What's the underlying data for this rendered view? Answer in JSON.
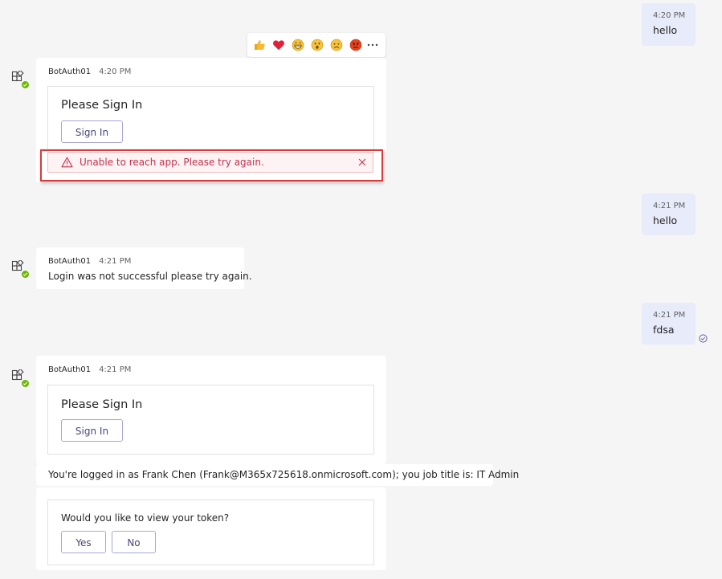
{
  "messages": {
    "m1": {
      "time": "4:20 PM",
      "text": "hello"
    },
    "m2": {
      "sender": "BotAuth01",
      "time": "4:20 PM",
      "card_title": "Please Sign In",
      "sign_in_label": "Sign In",
      "error_text": "Unable to reach app. Please try again."
    },
    "m3": {
      "time": "4:21 PM",
      "text": "hello"
    },
    "m4": {
      "sender": "BotAuth01",
      "time": "4:21 PM",
      "text": "Login was not successful please try again."
    },
    "m5": {
      "time": "4:21 PM",
      "text": "fdsa"
    },
    "m6": {
      "sender": "BotAuth01",
      "time": "4:21 PM",
      "card_title": "Please Sign In",
      "sign_in_label": "Sign In",
      "info_text": "You're logged in as Frank Chen (Frank@M365x725618.onmicrosoft.com); you job title is: IT Admin",
      "question": "Would you like to view your token?",
      "yes_label": "Yes",
      "no_label": "No"
    }
  },
  "reactions": [
    "like-icon",
    "heart-icon",
    "laugh-icon",
    "surprised-icon",
    "sad-icon",
    "angry-icon",
    "more-options-icon"
  ],
  "colors": {
    "accent": "#6264a7",
    "error": "#c4314b",
    "presence": "#6bb700",
    "my_bubble": "#e8ebfa",
    "highlight": "#d83b3b"
  }
}
